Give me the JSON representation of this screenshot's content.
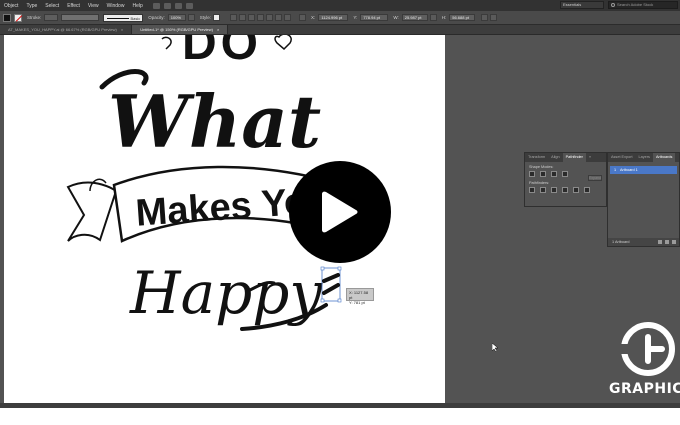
{
  "menubar": {
    "items": [
      "Object",
      "Type",
      "Select",
      "Effect",
      "View",
      "Window",
      "Help"
    ],
    "workspace": "Essentials",
    "search_placeholder": "Search Adobe Stock"
  },
  "controlbar": {
    "stroke_label": "Stroke:",
    "brush_label": "Basic",
    "opacity_label": "Opacity:",
    "opacity_value": "100%",
    "style_label": "Style:",
    "x_value": "1124.996 pt",
    "y_value": "778.94 pt",
    "w_value": "25.987 pt",
    "h_value": "56.688 pt"
  },
  "tabs": [
    {
      "label": "AT_MAKES_YOU_HAPPY.ai @ 66.67% (RGB/GPU Preview)",
      "active": false
    },
    {
      "label": "Untitled-1* @ 150% (RGB/GPU Preview)",
      "active": true
    }
  ],
  "artwork": {
    "word1": "DO",
    "word2": "What",
    "word3": "Makes You",
    "word4": "Happy"
  },
  "measure": {
    "line1": "X: 1127.58 pt",
    "line2": "Y: 781 pt"
  },
  "pathfinder_panel": {
    "tabs": [
      "Transform",
      "Align",
      "Pathfinder",
      "»"
    ],
    "active_tab": "Pathfinder",
    "shape_modes_label": "Shape Modes:",
    "expand_label": "Expand",
    "pathfinders_label": "Pathfinders:"
  },
  "artboards_panel": {
    "tabs": [
      "Asset Export",
      "Layers",
      "Artboards"
    ],
    "active_tab": "Artboards",
    "row_number": "1",
    "row_name": "Artboard 1",
    "footer": "1 Artboard"
  },
  "logo": {
    "word": "GRAPHIC"
  },
  "colors": {
    "app_bg": "#535353",
    "menubar": "#323232",
    "selection_blue": "#4a78c8",
    "artwork_ink": "#111111"
  }
}
